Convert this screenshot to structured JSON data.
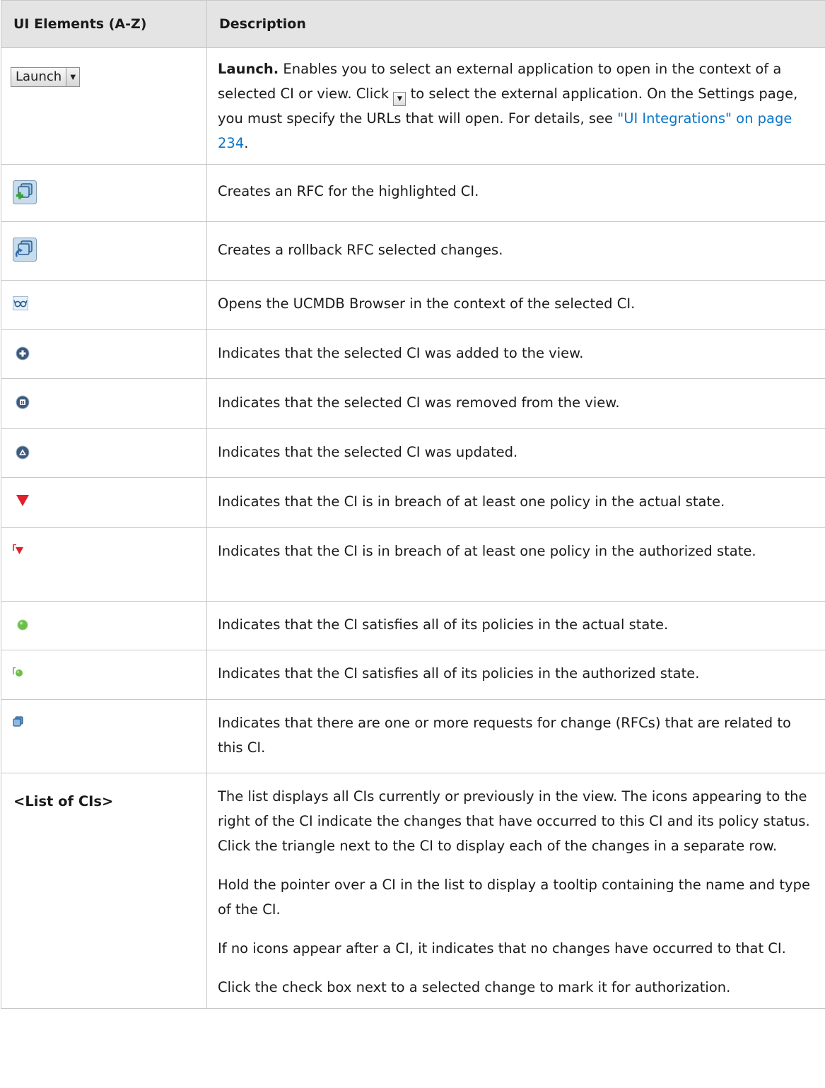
{
  "table": {
    "header": {
      "col1": "UI Elements (A-Z)",
      "col2": "Description"
    },
    "rows": [
      {
        "element_label": "Launch",
        "lead": "Launch.",
        "text_a": " Enables you to select an external application to open in the context of a selected CI or view. Click ",
        "text_b": " to select the external application. On the Settings page, you must specify the URLs that will open. For details, see ",
        "link": "\"UI Integrations\" on page 234",
        "text_c": "."
      },
      {
        "icon": "create-rfc-icon",
        "desc": "Creates an RFC for the highlighted CI."
      },
      {
        "icon": "rollback-rfc-icon",
        "desc": "Creates a rollback RFC selected changes."
      },
      {
        "icon": "browser-glasses-icon",
        "desc": "Opens the UCMDB Browser in the context of the selected CI."
      },
      {
        "icon": "added-icon",
        "desc": "Indicates that the selected CI was added to the view."
      },
      {
        "icon": "removed-icon",
        "desc": "Indicates that the selected CI was removed from the view."
      },
      {
        "icon": "updated-icon",
        "desc": "Indicates that the selected CI was updated."
      },
      {
        "icon": "breach-actual-icon",
        "desc": "Indicates that the CI is in breach of at least one policy in the actual state."
      },
      {
        "icon": "breach-authorized-icon",
        "desc": "Indicates that the CI is in breach of at least one policy in the authorized state."
      },
      {
        "icon": "satisfied-actual-icon",
        "desc": "Indicates that the CI satisfies all of its policies in the actual state."
      },
      {
        "icon": "satisfied-authorized-icon",
        "desc": "Indicates that the CI satisfies all of its policies in the authorized state."
      },
      {
        "icon": "rfc-related-icon",
        "desc": "Indicates that there are one or more requests for change (RFCs) that are related to this CI."
      },
      {
        "element": "<List of CIs>",
        "paragraphs": [
          "The list displays all CIs currently or previously in the view. The icons appearing to the right of the CI indicate the changes that have occurred to this CI and its policy status. Click the triangle next to the CI to display each of the changes in a separate row.",
          "Hold the pointer over a CI in the list to display a tooltip containing the name and type of the CI.",
          "If no icons appear after a CI, it indicates that no changes have occurred to that CI.",
          "Click the check box next to a selected change to mark it for authorization."
        ]
      }
    ]
  },
  "colors": {
    "header_bg": "#e4e4e4",
    "border": "#c8c8c8",
    "link": "#0a76c9"
  }
}
